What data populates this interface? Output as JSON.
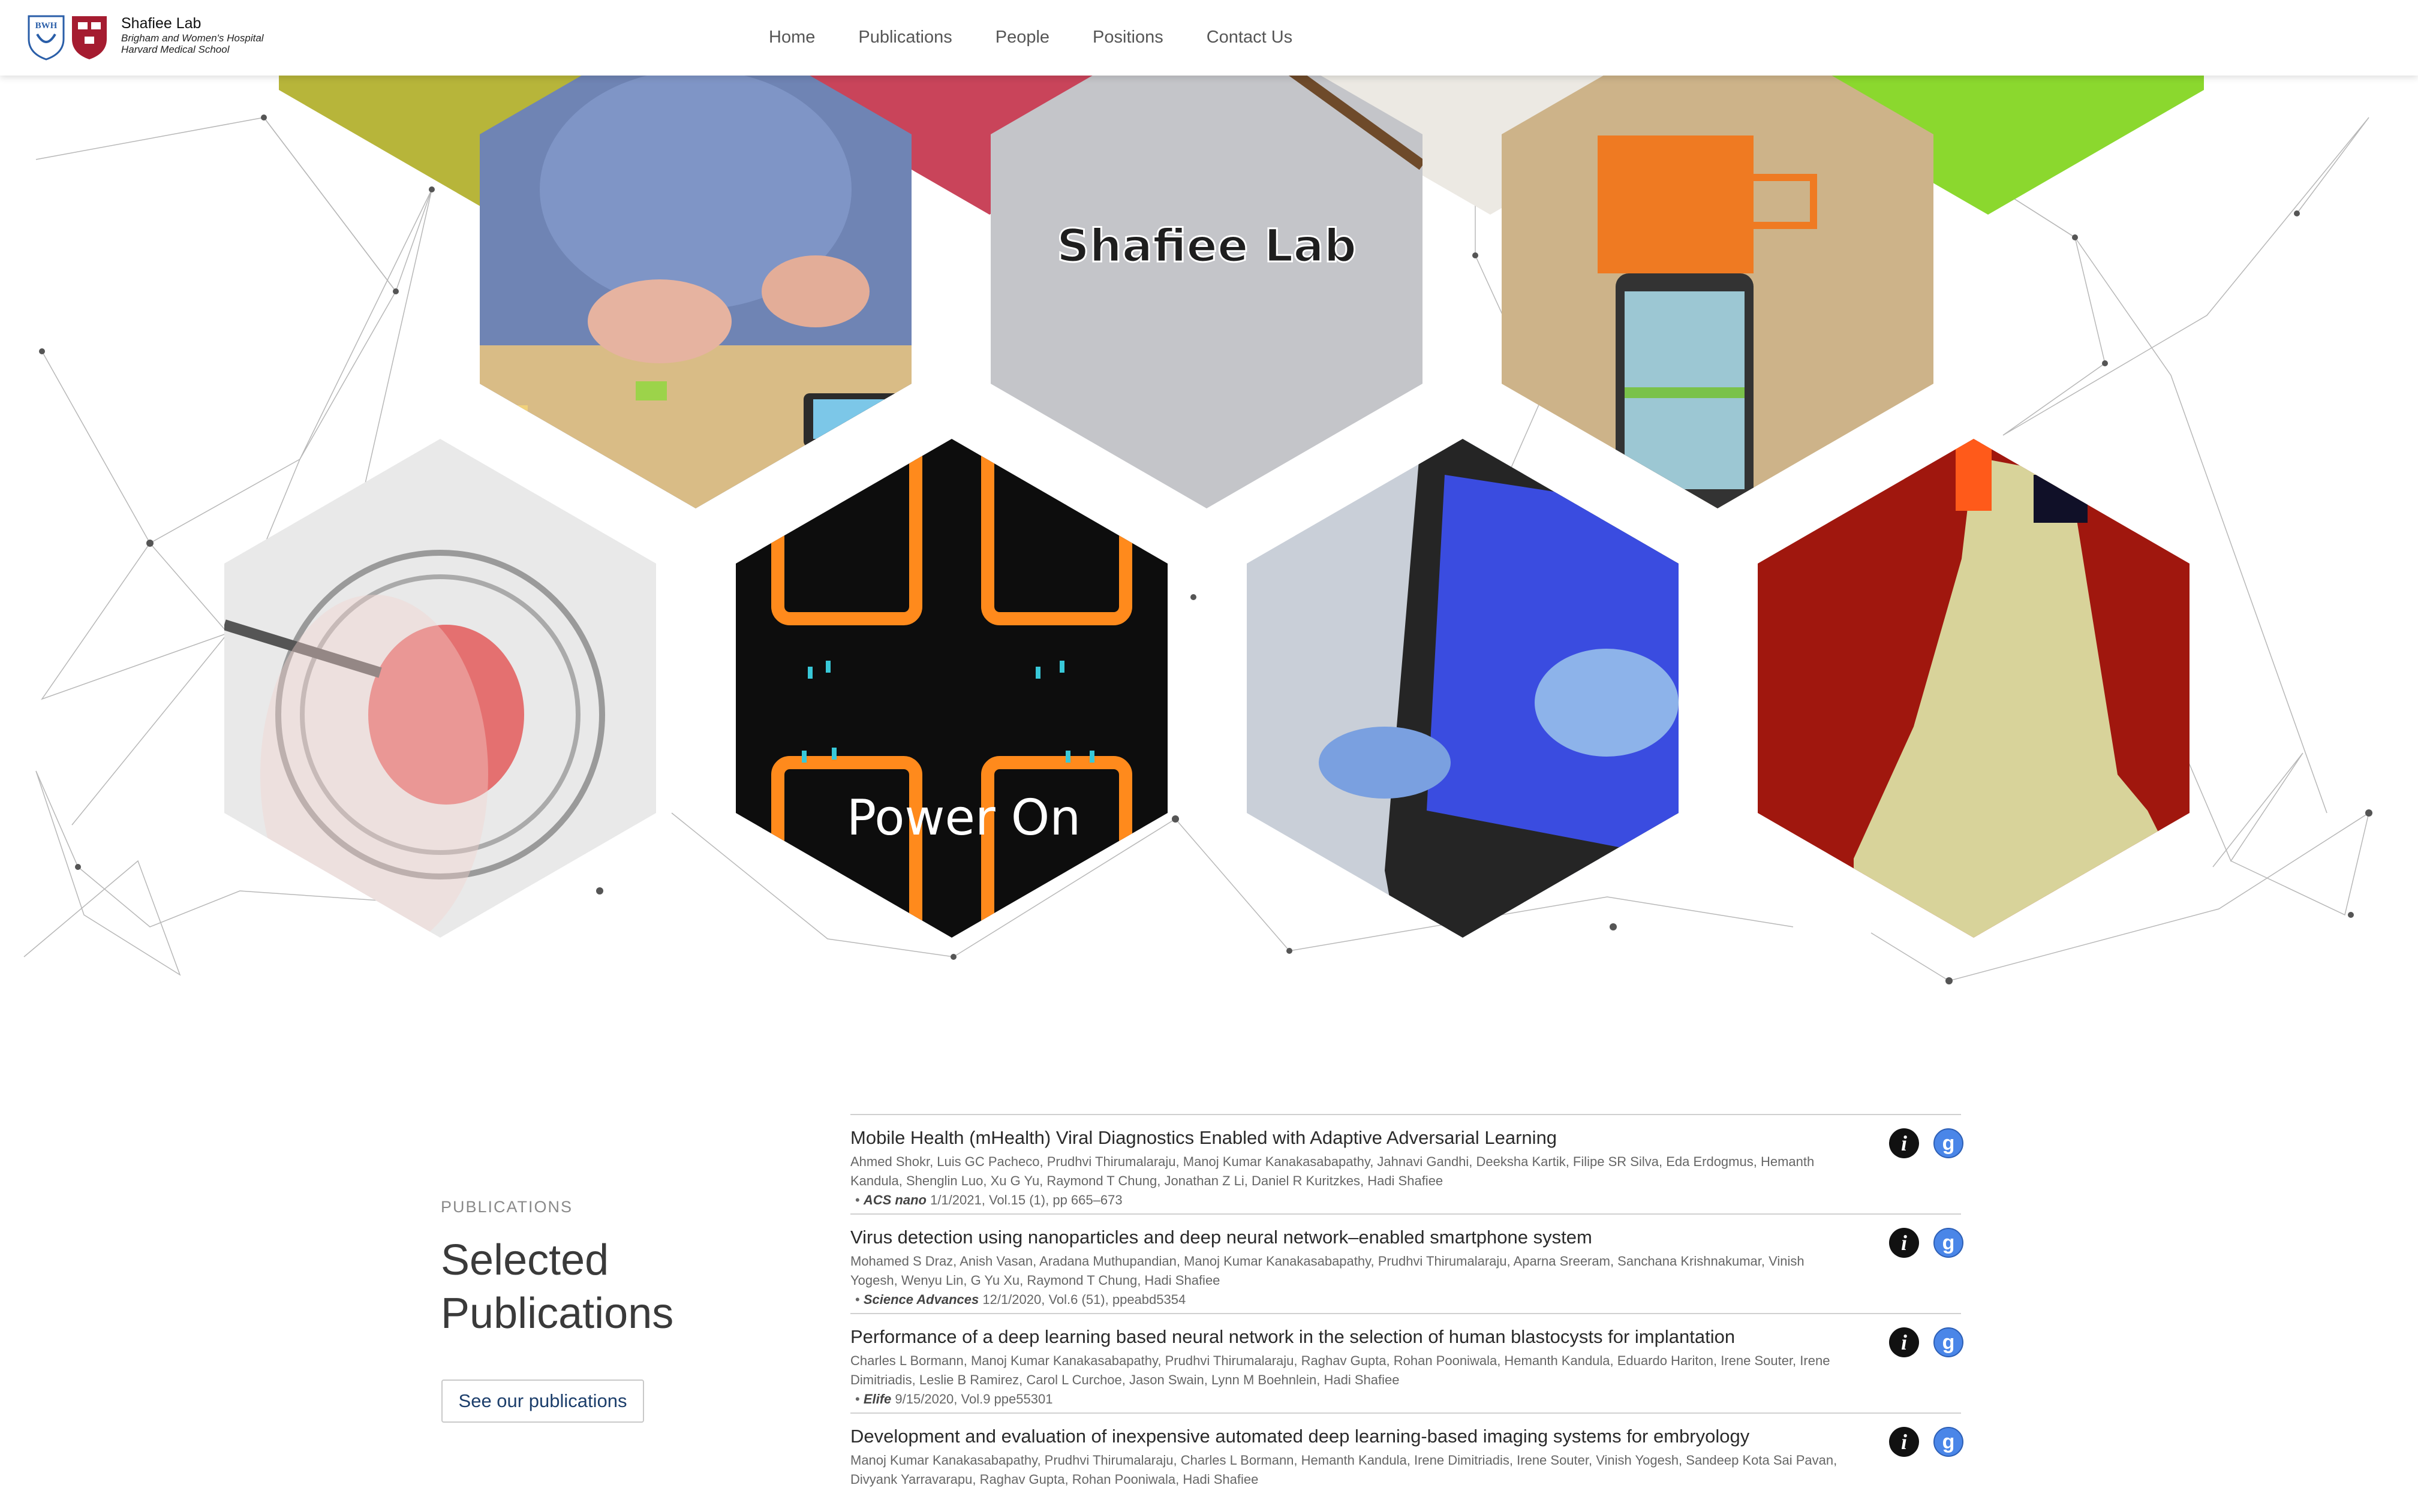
{
  "header": {
    "lab_name": "Shafiee Lab",
    "affiliation_1": "Brigham and Women's Hospital",
    "affiliation_2": "Harvard Medical School",
    "bwh_logo_text": "BWH",
    "nav": [
      "Home",
      "Publications",
      "People",
      "Positions",
      "Contact Us"
    ]
  },
  "hero": {
    "tiles": [
      {
        "name": "hex-smartphone-test"
      },
      {
        "name": "hex-shafiee-lab-sign",
        "caption": "Shafiee Lab"
      },
      {
        "name": "hex-orange-device-phone"
      },
      {
        "name": "hex-microchip"
      },
      {
        "name": "hex-power-on-video",
        "caption": "Power On"
      },
      {
        "name": "hex-phone-app"
      },
      {
        "name": "hex-segmentation-map"
      }
    ]
  },
  "publications": {
    "label": "PUBLICATIONS",
    "title": "Selected Publications",
    "button": "See our publications",
    "items": [
      {
        "title": "Mobile Health (mHealth) Viral Diagnostics Enabled with Adaptive Adversarial Learning",
        "authors": "Ahmed Shokr, Luis GC Pacheco, Prudhvi Thirumalaraju, Manoj Kumar Kanakasabapathy, Jahnavi Gandhi, Deeksha Kartik, Filipe SR Silva, Eda Erdogmus, Hemanth Kandula, Shenglin Luo, Xu G Yu, Raymond T Chung, Jonathan Z Li, Daniel R Kuritzkes, Hadi Shafiee",
        "journal": "ACS nano",
        "details": "1/1/2021, Vol.15 (1), pp 665–673"
      },
      {
        "title": "Virus detection using nanoparticles and deep neural network–enabled smartphone system",
        "authors": "Mohamed S Draz, Anish Vasan, Aradana Muthupandian, Manoj Kumar Kanakasabapathy, Prudhvi Thirumalaraju, Aparna Sreeram, Sanchana Krishnakumar, Vinish Yogesh, Wenyu Lin, G Yu Xu, Raymond T Chung, Hadi Shafiee",
        "journal": "Science Advances",
        "details": "12/1/2020, Vol.6 (51), ppeabd5354"
      },
      {
        "title": "Performance of a deep learning based neural network in the selection of human blastocysts for implantation",
        "authors": "Charles L Bormann, Manoj Kumar Kanakasabapathy, Prudhvi Thirumalaraju, Raghav Gupta, Rohan Pooniwala, Hemanth Kandula, Eduardo Hariton, Irene Souter, Irene Dimitriadis, Leslie B Ramirez, Carol L Curchoe, Jason Swain, Lynn M Boehnlein, Hadi Shafiee",
        "journal": "Elife",
        "details": "9/15/2020, Vol.9 ppe55301"
      },
      {
        "title": "Development and evaluation of inexpensive automated deep learning-based imaging systems for embryology",
        "authors": "Manoj Kumar Kanakasabapathy, Prudhvi Thirumalaraju, Charles L Bormann, Hemanth Kandula, Irene Dimitriadis, Irene Souter, Vinish Yogesh, Sandeep Kota Sai Pavan, Divyank Yarravarapu, Raghav Gupta, Rohan Pooniwala, Hadi Shafiee",
        "journal": "",
        "details": ""
      }
    ],
    "info_icon": "i",
    "scholar_icon": "g"
  },
  "colors": {
    "nav_text": "#555555",
    "link_dark_blue": "#1c3e6b",
    "scholar_blue": "#4a86e8",
    "orange_glow": "#ff8a1c"
  }
}
